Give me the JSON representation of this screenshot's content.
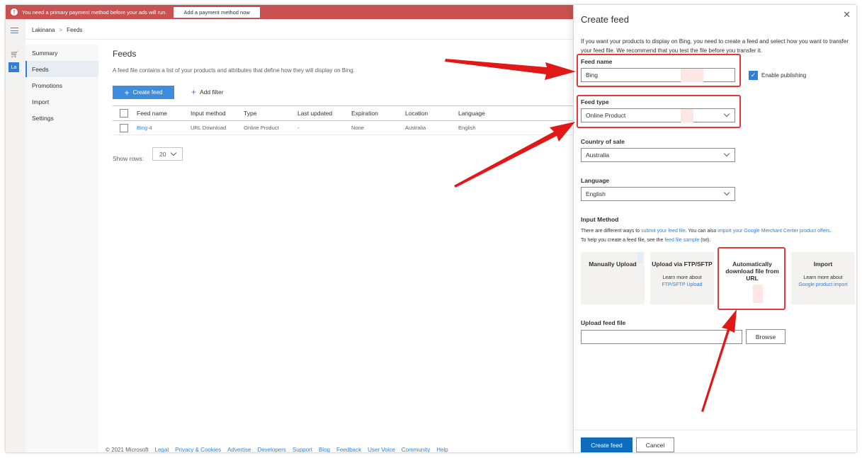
{
  "notification": {
    "message": "You need a primary payment method before your ads will run.",
    "button": "Add a payment method now",
    "icon": "warning-icon"
  },
  "rail": {
    "account_badge": "La"
  },
  "breadcrumb": {
    "account": "Lakinana",
    "separator": ">",
    "page": "Feeds"
  },
  "nav": {
    "items": [
      {
        "label": "Summary"
      },
      {
        "label": "Feeds"
      },
      {
        "label": "Promotions"
      },
      {
        "label": "Import"
      },
      {
        "label": "Settings"
      }
    ],
    "active": "Feeds"
  },
  "main": {
    "title": "Feeds",
    "description": "A feed file contains a list of your products and attributes that define how they will display on Bing.",
    "create_button": "Create feed",
    "add_filter": "Add filter",
    "table": {
      "headers": [
        "Feed name",
        "Input method",
        "Type",
        "Last updated",
        "Expiration",
        "Location",
        "Language"
      ],
      "rows": [
        [
          "Bing-4",
          "URL Download",
          "Online Product",
          "-",
          "None",
          "Australia",
          "English"
        ]
      ]
    },
    "show_rows_label": "Show rows:",
    "show_rows_value": "20"
  },
  "footer": {
    "copyright": "© 2021 Microsoft",
    "links": [
      "Legal",
      "Privacy & Cookies",
      "Advertise",
      "Developers",
      "Support",
      "Blog",
      "Feedback",
      "User Voice",
      "Community",
      "Help"
    ]
  },
  "panel": {
    "title": "Create feed",
    "intro": "If you want your products to display on Bing, you need to create a feed and select how you want to transfer your feed file. We recommend that you test the file before you transfer it.",
    "feed_name_label": "Feed name",
    "feed_name_value": "Bing",
    "enable_publishing_label": "Enable publishing",
    "enable_publishing_checked": true,
    "feed_type_label": "Feed type",
    "feed_type_value": "Online Product",
    "country_label": "Country of sale",
    "country_value": "Australia",
    "language_label": "Language",
    "language_value": "English",
    "input_method_label": "Input Method",
    "input_method_desc": {
      "a": "There are different ways to ",
      "link1": "submit your feed file",
      "b": ". You can also ",
      "link2": "import your Google Merchant Center product offers",
      "c": ".",
      "d": "To help you create a feed file, see the ",
      "link3": "feed file sample",
      "e": " (txt)."
    },
    "tiles": [
      {
        "title": "Manually Upload",
        "sub": "",
        "link": ""
      },
      {
        "title": "Upload via FTP/SFTP",
        "sub": "Learn more about",
        "link": "FTP/SFTP Upload"
      },
      {
        "title": "Automatically download file from URL",
        "sub": "",
        "link": ""
      },
      {
        "title": "Import",
        "sub": "Learn more about",
        "link": "Google product import"
      }
    ],
    "upload_label": "Upload feed file",
    "browse_button": "Browse",
    "submit_button": "Create feed",
    "cancel_button": "Cancel"
  },
  "colors": {
    "notification_bar": "#c85252",
    "primary": "#0f6cbd",
    "link": "#2f7fd8",
    "annotation": "#e23a3a"
  }
}
